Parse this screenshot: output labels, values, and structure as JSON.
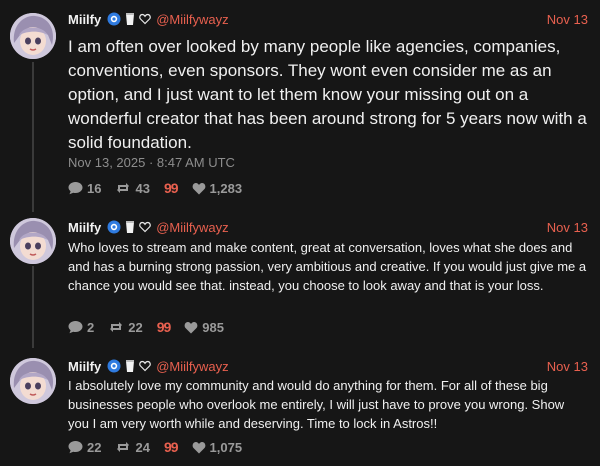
{
  "posts": [
    {
      "author": "Miilfy",
      "handle": "@Miilfywayz",
      "date": "Nov 13",
      "text": "I am often over looked by many people like agencies, companies, conventions, even sponsors. They wont even consider me as an option, and I just want to let them know your missing out on a wonderful creator that has been around strong for 5 years now with a solid foundation.",
      "timestamp": "Nov 13, 2025 · 8:47 AM UTC",
      "replies": "16",
      "reposts": "43",
      "quote_glyph": "99",
      "likes": "1,283"
    },
    {
      "author": "Miilfy",
      "handle": "@Miilfywayz",
      "date": "Nov 13",
      "text": "Who loves to stream and make content, great at conversation, loves what she does and and has a burning strong passion, very ambitious and creative. If you would just give me a chance you would see that. instead, you choose to look away and that is your loss.",
      "replies": "2",
      "reposts": "22",
      "quote_glyph": "99",
      "likes": "985"
    },
    {
      "author": "Miilfy",
      "handle": "@Miilfywayz",
      "date": "Nov 13",
      "text": "I absolutely love my community and would do anything for them. For all of these big businesses people who overlook me entirely, I will just have to prove you wrong. Show you I am very worth while and deserving. Time to lock in Astros!!",
      "replies": "22",
      "reposts": "24",
      "quote_glyph": "99",
      "likes": "1,075"
    }
  ],
  "colors": {
    "accent": "#e8604f",
    "badge_blue": "#2f7be0",
    "background": "#161616",
    "muted": "#8d8d8d"
  },
  "icons": [
    "verified-badge-icon",
    "cup-icon",
    "heart-outline-icon",
    "comment-icon",
    "repost-icon",
    "quote-icon",
    "heart-icon"
  ]
}
